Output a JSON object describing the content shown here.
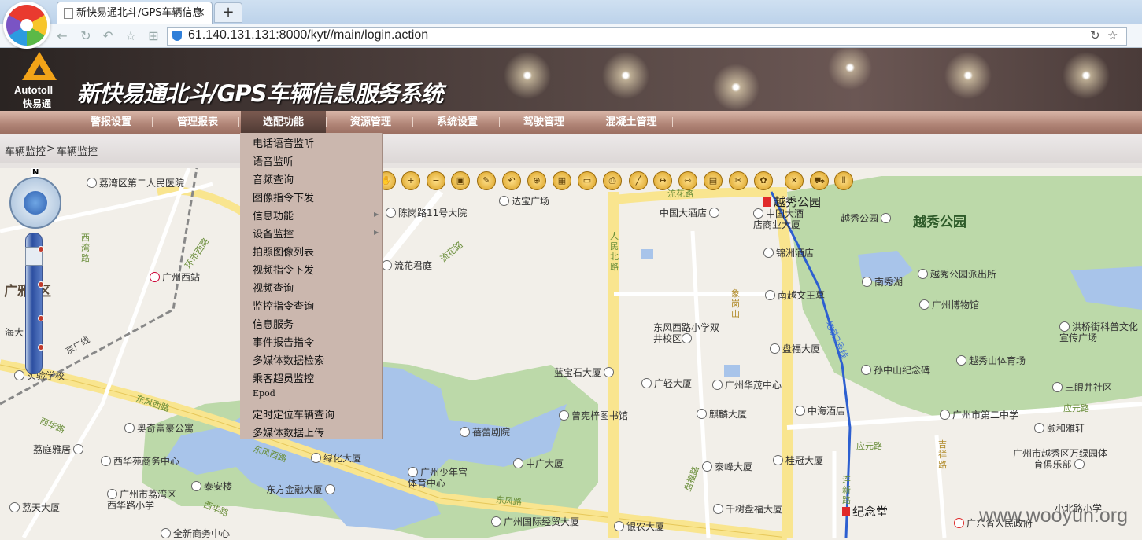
{
  "browser": {
    "tab_title": "新快易通北斗/GPS车辆信息",
    "tab_close": "×",
    "newtab": "+",
    "url": "61.140.131.131:8000/kyt//main/login.action"
  },
  "header": {
    "logo_text": "Autotoll",
    "logo_cn": "快易通",
    "system_title": "新快易通北斗/GPS车辆信息服务系统"
  },
  "menu": [
    {
      "label": "警报设置"
    },
    {
      "label": "管理报表"
    },
    {
      "label": "选配功能"
    },
    {
      "label": "资源管理"
    },
    {
      "label": "系统设置"
    },
    {
      "label": "驾驶管理"
    },
    {
      "label": "混凝土管理"
    }
  ],
  "breadcrumb": {
    "level1": "车辆监控",
    "sep": ">",
    "level2": "车辆监控"
  },
  "dropdown": [
    {
      "label": "电话语音监听"
    },
    {
      "label": "语音监听"
    },
    {
      "label": "音频查询"
    },
    {
      "label": "图像指令下发"
    },
    {
      "label": "信息功能",
      "submenu": true
    },
    {
      "label": "设备监控",
      "submenu": true
    },
    {
      "label": "拍照图像列表"
    },
    {
      "label": "视频指令下发"
    },
    {
      "label": "视频查询"
    },
    {
      "label": "监控指令查询"
    },
    {
      "label": "信息服务"
    },
    {
      "label": "事件报告指令"
    },
    {
      "label": "多媒体数据检索"
    },
    {
      "label": "乘客超员监控"
    },
    {
      "label": "Epod"
    },
    {
      "label": "定时定位车辆查询"
    },
    {
      "label": "多媒体数据上传"
    }
  ],
  "map": {
    "compass_n": "N",
    "pois": [
      {
        "name": "荔湾区第二人民医院"
      },
      {
        "name": "广州西站"
      },
      {
        "name": "陈岗路11号大院"
      },
      {
        "name": "达宝广场"
      },
      {
        "name": "中国大酒店"
      },
      {
        "name": "中国大酒店商业大厦"
      },
      {
        "name": "锦洲酒店"
      },
      {
        "name": "流花君庭"
      },
      {
        "name": "南越文王墓"
      },
      {
        "name": "东风西路小学双井校区"
      },
      {
        "name": "盘福大厦"
      },
      {
        "name": "蓝宝石大厦"
      },
      {
        "name": "广轻大厦"
      },
      {
        "name": "广州华茂中心"
      },
      {
        "name": "中海酒店"
      },
      {
        "name": "曾宪梓图书馆"
      },
      {
        "name": "麒麟大厦"
      },
      {
        "name": "蓓蕾剧院"
      },
      {
        "name": "奥奇富豪公寓"
      },
      {
        "name": "荔庭雅居"
      },
      {
        "name": "西华苑商务中心"
      },
      {
        "name": "绿化大厦"
      },
      {
        "name": "中广大厦"
      },
      {
        "name": "泰峰大厦"
      },
      {
        "name": "桂冠大厦"
      },
      {
        "name": "泰安楼"
      },
      {
        "name": "东方金融大厦"
      },
      {
        "name": "广州少年宫体育中心"
      },
      {
        "name": "荔天大厦"
      },
      {
        "name": "广州市荔湾区西华路小学"
      },
      {
        "name": "千树盘福大厦"
      },
      {
        "name": "全新商务中心"
      },
      {
        "name": "广州国际经贸大厦"
      },
      {
        "name": "银农大厦"
      },
      {
        "name": "越秀公园"
      },
      {
        "name": "南秀湖"
      },
      {
        "name": "越秀公园派出所"
      },
      {
        "name": "广州博物馆"
      },
      {
        "name": "洪桥街科普文化宣传广场"
      },
      {
        "name": "越秀山体育场"
      },
      {
        "name": "孙中山纪念碑"
      },
      {
        "name": "三眼井社区"
      },
      {
        "name": "广州市第二中学"
      },
      {
        "name": "颐和雅轩"
      },
      {
        "name": "广州市越秀区万绿园体育俱乐部"
      },
      {
        "name": "小北路小学"
      },
      {
        "name": "广东省人民政府"
      },
      {
        "name": "实验学校"
      }
    ],
    "big_labels": [
      "越秀公园",
      "广雅",
      "区"
    ],
    "metro": [
      {
        "name": "越秀公园"
      },
      {
        "name": "纪念堂"
      }
    ],
    "roads": [
      "流花路",
      "人民北路",
      "东风西路",
      "东风西路",
      "东风路",
      "西华路",
      "环市西路",
      "盘福路",
      "应元路",
      "连新路",
      "吉祥路",
      "地铁2号线",
      "广园路",
      "象岗山",
      "西湾路",
      "应元路",
      "京广线",
      "海大"
    ],
    "watermark": "www.wooyun.org"
  }
}
